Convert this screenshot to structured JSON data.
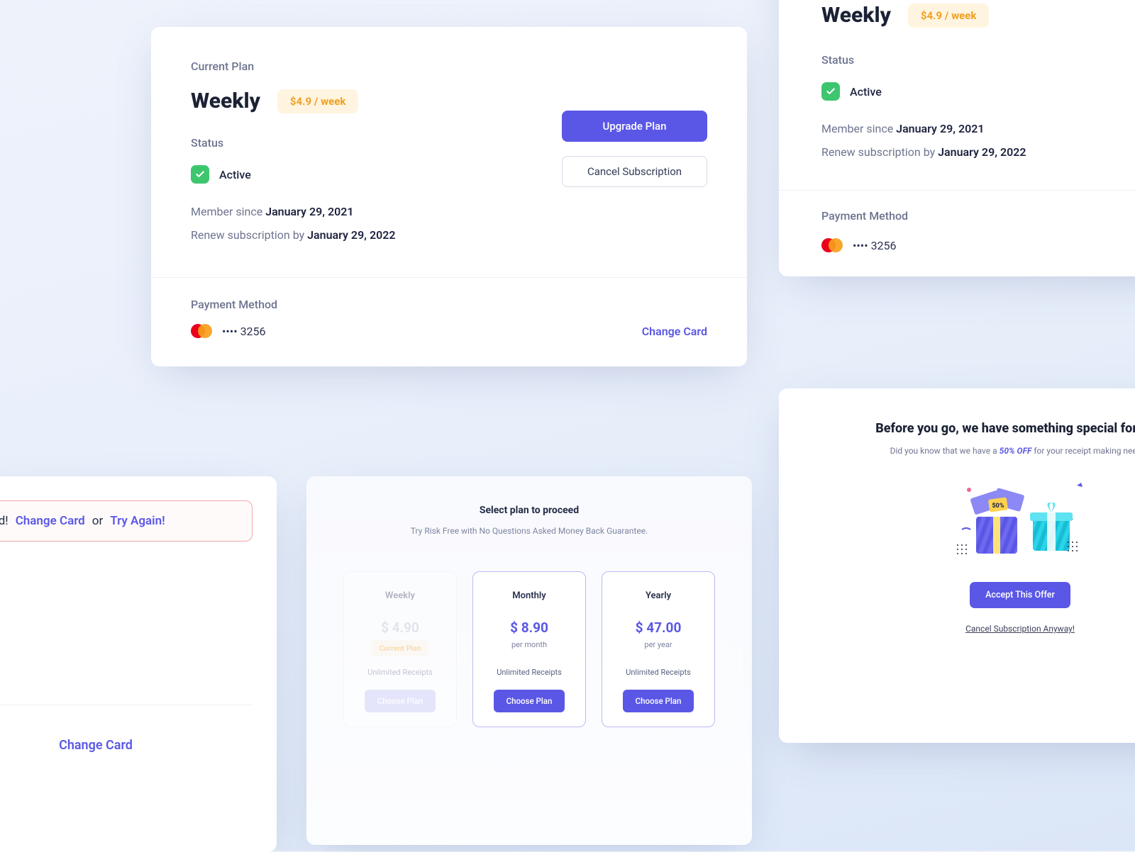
{
  "main": {
    "current_plan_label": "Current Plan",
    "plan_name": "Weekly",
    "price_pill": "$4.9 / week",
    "upgrade_btn": "Upgrade Plan",
    "cancel_btn": "Cancel Subscription",
    "status_label": "Status",
    "status_value": "Active",
    "member_since_label": "Member since",
    "member_since_value": "January 29, 2021",
    "renew_label": "Renew subscription by",
    "renew_value": "January 29, 2022",
    "pm_label": "Payment Method",
    "card_masked": "•••• 3256",
    "change_card": "Change Card"
  },
  "error": {
    "prefix": "your card!",
    "change": "Change Card",
    "or": "or",
    "retry": "Try Again!",
    "footer_change": "Change Card"
  },
  "plans": {
    "title": "Select plan to proceed",
    "subtitle": "Try Risk Free with No Questions Asked Money Back Guarantee.",
    "weekly": {
      "name": "Weekly",
      "price": "$ 4.90",
      "badge": "Current Plan",
      "feature": "Unlimited Receipts",
      "cta": "Choose Plan"
    },
    "monthly": {
      "name": "Monthly",
      "price": "$ 8.90",
      "per": "per month",
      "feature": "Unlimited Receipts",
      "cta": "Choose Plan"
    },
    "yearly": {
      "name": "Yearly",
      "price": "$ 47.00",
      "per": "per year",
      "feature": "Unlimited Receipts",
      "cta": "Choose Plan"
    }
  },
  "offer": {
    "title": "Before you go, we have something special for you!",
    "sub_pre": "Did you know that we have a ",
    "sub_em": "50% OFF",
    "sub_post": " for your receipt making needs?",
    "accept": "Accept This Offer",
    "cancel": "Cancel Subscription Anyway!",
    "discount_badge": "50%"
  }
}
